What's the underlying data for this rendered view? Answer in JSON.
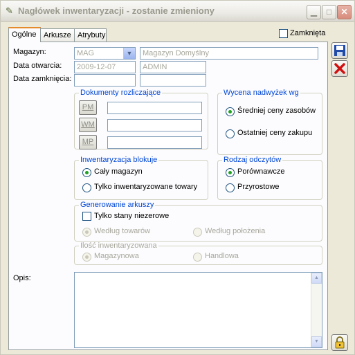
{
  "window": {
    "title": "Nagłówek inwentaryzacji - zostanie zmieniony",
    "close_color": "#d88c7c"
  },
  "tabs": [
    {
      "label": "Ogólne"
    },
    {
      "label": "Arkusze"
    },
    {
      "label": "Atrybuty"
    }
  ],
  "closed_checkbox": {
    "label": "Zamknięta",
    "checked": false
  },
  "fields": {
    "magazyn_label": "Magazyn:",
    "magazyn_code": "MAG",
    "magazyn_name": "Magazyn Domyślny",
    "data_otwarcia_label": "Data otwarcia:",
    "data_otwarcia": "2009-12-07",
    "operator": "ADMIN",
    "data_zamkniecia_label": "Data zamknięcia:",
    "data_zamkniecia": "",
    "data_zamkniecia_operator": ""
  },
  "dokumenty": {
    "title": "Dokumenty rozliczające",
    "items": [
      {
        "btn": "PM",
        "value": ""
      },
      {
        "btn": "WM",
        "value": ""
      },
      {
        "btn": "MP",
        "value": ""
      }
    ]
  },
  "wycena": {
    "title": "Wycena nadwyżek wg",
    "options": [
      {
        "label": "Średniej ceny zasobów",
        "selected": true
      },
      {
        "label": "Ostatniej ceny zakupu",
        "selected": false
      }
    ]
  },
  "blokuje": {
    "title": "Inwentaryzacja blokuje",
    "options": [
      {
        "label": "Cały magazyn",
        "selected": true
      },
      {
        "label": "Tylko inwentaryzowane towary",
        "selected": false
      }
    ]
  },
  "odczyty": {
    "title": "Rodzaj odczytów",
    "options": [
      {
        "label": "Porównawcze",
        "selected": true
      },
      {
        "label": "Przyrostowe",
        "selected": false
      }
    ]
  },
  "generowanie": {
    "title": "Generowanie arkuszy",
    "checkbox": "Tylko stany niezerowe",
    "options": [
      {
        "label": "Według towarów",
        "selected": true
      },
      {
        "label": "Według położenia",
        "selected": false
      }
    ]
  },
  "ilosc": {
    "title": "Ilość inwentaryzowana",
    "options": [
      {
        "label": "Magazynowa",
        "selected": true
      },
      {
        "label": "Handlowa",
        "selected": false
      }
    ]
  },
  "opis": {
    "label": "Opis:",
    "value": ""
  },
  "icons": {
    "title": "document-edit-icon",
    "save": "save-icon",
    "cancel": "cancel-icon",
    "lock": "lock-icon"
  }
}
